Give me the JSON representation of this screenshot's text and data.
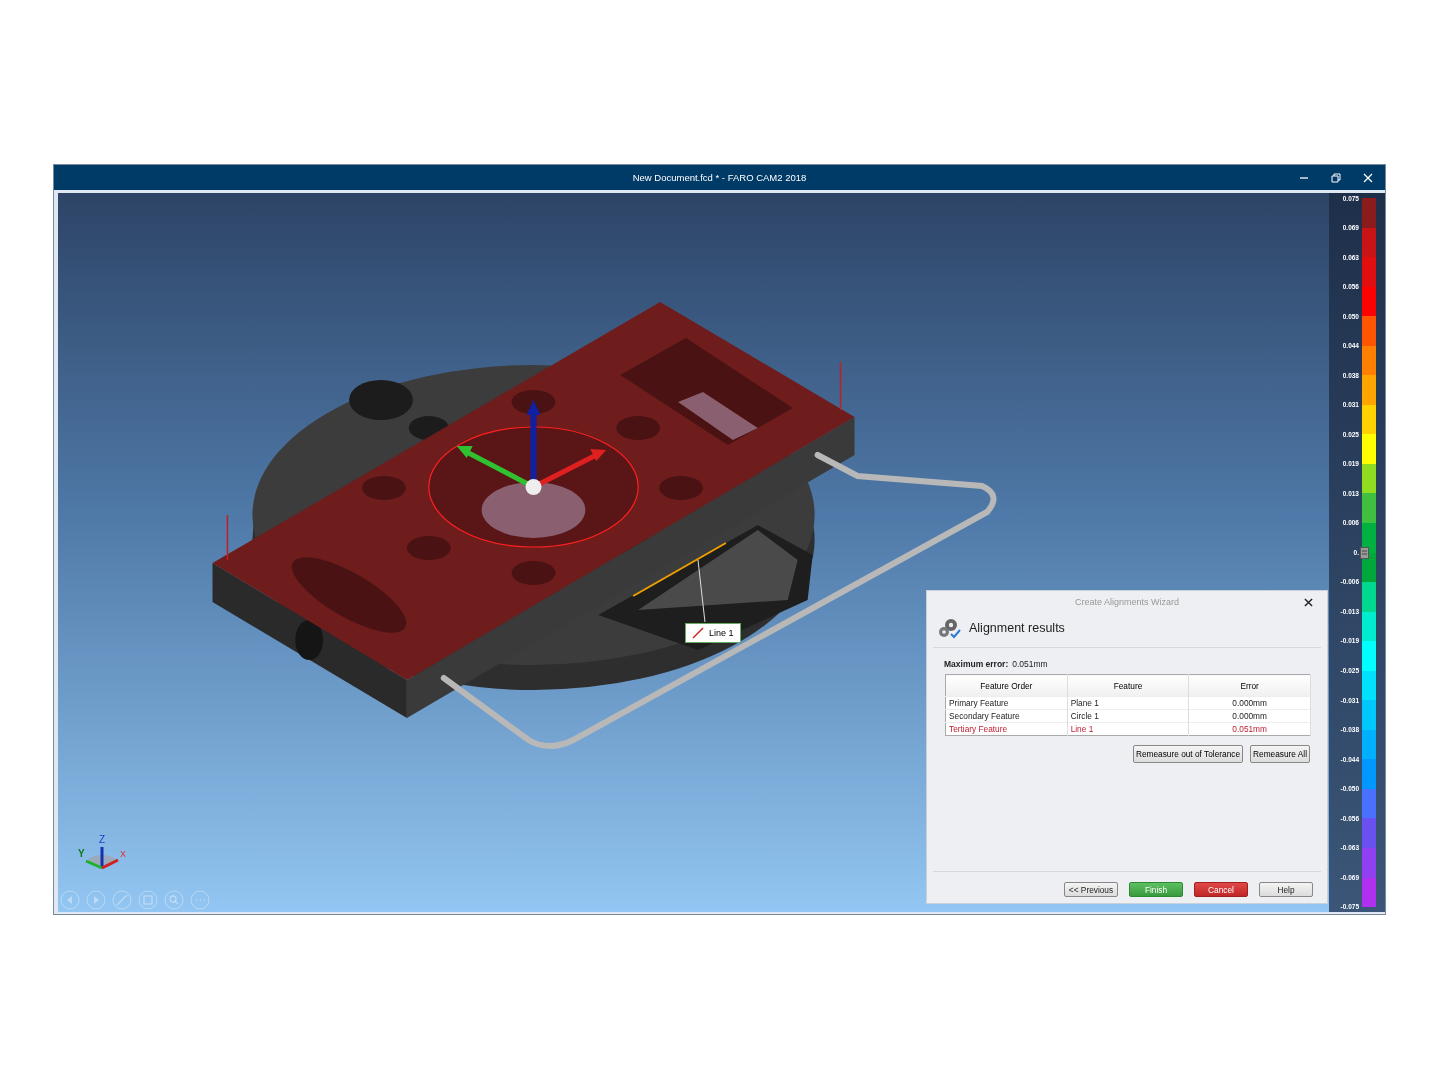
{
  "window": {
    "title": "New Document.fcd * - FARO CAM2 2018"
  },
  "viewport": {
    "callout": {
      "label": "Line 1"
    },
    "triad": {
      "x": "X",
      "y": "Y",
      "z": "Z"
    }
  },
  "color_scale": {
    "slider": {
      "level": 0.5
    },
    "labels": [
      "0.075",
      "0.069",
      "0.063",
      "0.056",
      "0.050",
      "0.044",
      "0.038",
      "0.031",
      "0.025",
      "0.019",
      "0.013",
      "0.006",
      "0.",
      "-0.006",
      "-0.013",
      "-0.019",
      "-0.025",
      "-0.031",
      "-0.038",
      "-0.044",
      "-0.050",
      "-0.056",
      "-0.063",
      "-0.069",
      "-0.075"
    ],
    "bands": [
      {
        "color": "#8b1c1c"
      },
      {
        "color": "#c81414"
      },
      {
        "color": "#e00e0e"
      },
      {
        "color": "#ff0000"
      },
      {
        "color": "#ff5500"
      },
      {
        "color": "#ff8000"
      },
      {
        "color": "#ffa500"
      },
      {
        "color": "#ffd200"
      },
      {
        "color": "#ffff00"
      },
      {
        "color": "#90dc20"
      },
      {
        "color": "#40c040"
      },
      {
        "color": "#00b040"
      },
      {
        "color": "#00a83c"
      },
      {
        "color": "#00d890"
      },
      {
        "color": "#00ecd0"
      },
      {
        "color": "#00ffff"
      },
      {
        "color": "#00e0ff"
      },
      {
        "color": "#00c8ff"
      },
      {
        "color": "#00b0ff"
      },
      {
        "color": "#0098ff"
      },
      {
        "color": "#4a70ff"
      },
      {
        "color": "#6a50f0"
      },
      {
        "color": "#9040f0"
      },
      {
        "color": "#b030f0"
      }
    ]
  },
  "dialog": {
    "title": "Create Alignments Wizard",
    "heading": "Alignment results",
    "max_error_label": "Maximum error:",
    "max_error_value": "0.051mm",
    "columns": [
      "Feature Order",
      "Feature",
      "Error"
    ],
    "rows": [
      {
        "cells": [
          "Primary Feature",
          "Plane 1",
          "0.000mm"
        ],
        "out_of_tolerance": false
      },
      {
        "cells": [
          "Secondary Feature",
          "Circle 1",
          "0.000mm"
        ],
        "out_of_tolerance": false
      },
      {
        "cells": [
          "Tertiary Feature",
          "Line 1",
          "0.051mm"
        ],
        "out_of_tolerance": true
      }
    ],
    "actions": [
      "Remeasure out of Tolerance",
      "Remeasure All"
    ],
    "buttons": [
      {
        "label": "<< Previous",
        "kind": "default"
      },
      {
        "label": "Finish",
        "kind": "finish"
      },
      {
        "label": "Cancel",
        "kind": "cancel"
      },
      {
        "label": "Help",
        "kind": "default"
      }
    ]
  }
}
